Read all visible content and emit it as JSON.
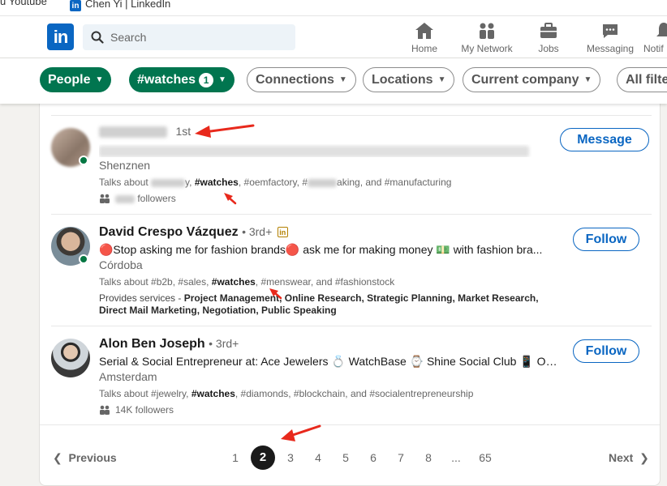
{
  "bookmarks": {
    "item1": "u Youtube",
    "item2": "Chen Yi | LinkedIn"
  },
  "header": {
    "logo_text": "in",
    "search_placeholder": "Search",
    "nav": [
      {
        "label": "Home",
        "icon": "home-icon"
      },
      {
        "label": "My Network",
        "icon": "network-icon"
      },
      {
        "label": "Jobs",
        "icon": "briefcase-icon"
      },
      {
        "label": "Messaging",
        "icon": "messaging-icon"
      },
      {
        "label": "Notif",
        "icon": "bell-icon"
      }
    ]
  },
  "filters": {
    "people": "People",
    "hashtag": "#watches",
    "hashtag_count": "1",
    "connections": "Connections",
    "locations": "Locations",
    "current_company": "Current company",
    "all_filters": "All filte"
  },
  "results": [
    {
      "name": "",
      "degree": "1st",
      "headline": "",
      "location": "Shenznen",
      "talks_prefix": "Talks about",
      "talks_bold": "#watches",
      "talks_rest": ", #oemfactory, #",
      "talks_tail": "aking, and #manufacturing",
      "followers": "followers",
      "action": "Message"
    },
    {
      "name": "David Crespo Vázquez",
      "degree": "• 3rd+",
      "headline": "🔴Stop asking me for fashion brands🔴 ask me for making money 💵 with fashion bra...",
      "location": "Córdoba",
      "talks_prefix": "Talks about #b2b, #sales,",
      "talks_bold": "#watches",
      "talks_rest": ", #menswear, and #fashionstock",
      "services_prefix": "Provides services -",
      "services_list": "Project Management, Online Research, Strategic Planning, Market Research, Direct Mail Marketing, Negotiation, Public Speaking",
      "action": "Follow"
    },
    {
      "name": "Alon Ben Joseph",
      "degree": "• 3rd+",
      "headline": "Serial & Social Entrepreneur at: Ace Jewelers 💍 WatchBase ⌚ Shine Social Club 📱 Oak...",
      "location": "Amsterdam",
      "talks_prefix": "Talks about #jewelry,",
      "talks_bold": "#watches",
      "talks_rest": ", #diamonds, #blockchain, and #socialentrepreneurship",
      "followers": "14K followers",
      "action": "Follow"
    }
  ],
  "pagination": {
    "previous": "Previous",
    "next": "Next",
    "pages": [
      "1",
      "2",
      "3",
      "4",
      "5",
      "6",
      "7",
      "8",
      "...",
      "65"
    ],
    "current": "2"
  },
  "colors": {
    "linkedin_blue": "#0a66c2",
    "filter_green": "#01754f",
    "annotation_red": "#e8291c"
  }
}
